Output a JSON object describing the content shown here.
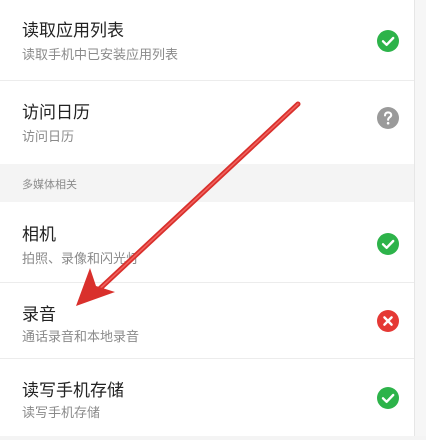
{
  "permissions": {
    "app_list": {
      "title": "读取应用列表",
      "desc": "读取手机中已安装应用列表",
      "status": "allowed",
      "status_icon": "check-circle-icon",
      "status_color": "#2db34a"
    },
    "calendar": {
      "title": "访问日历",
      "desc": "访问日历",
      "status": "ask",
      "status_icon": "question-circle-icon",
      "status_color": "#9a9a9a"
    }
  },
  "section": {
    "label": "多媒体相关"
  },
  "media": {
    "camera": {
      "title": "相机",
      "desc": "拍照、录像和闪光灯",
      "status": "allowed",
      "status_icon": "check-circle-icon",
      "status_color": "#2db34a"
    },
    "record": {
      "title": "录音",
      "desc": "通话录音和本地录音",
      "status": "denied",
      "status_icon": "close-circle-icon",
      "status_color": "#e53935"
    },
    "storage": {
      "title": "读写手机存储",
      "desc": "读写手机存储",
      "status": "allowed",
      "status_icon": "check-circle-icon",
      "status_color": "#2db34a"
    }
  },
  "annotation": {
    "arrow_color": "#d9302c"
  }
}
